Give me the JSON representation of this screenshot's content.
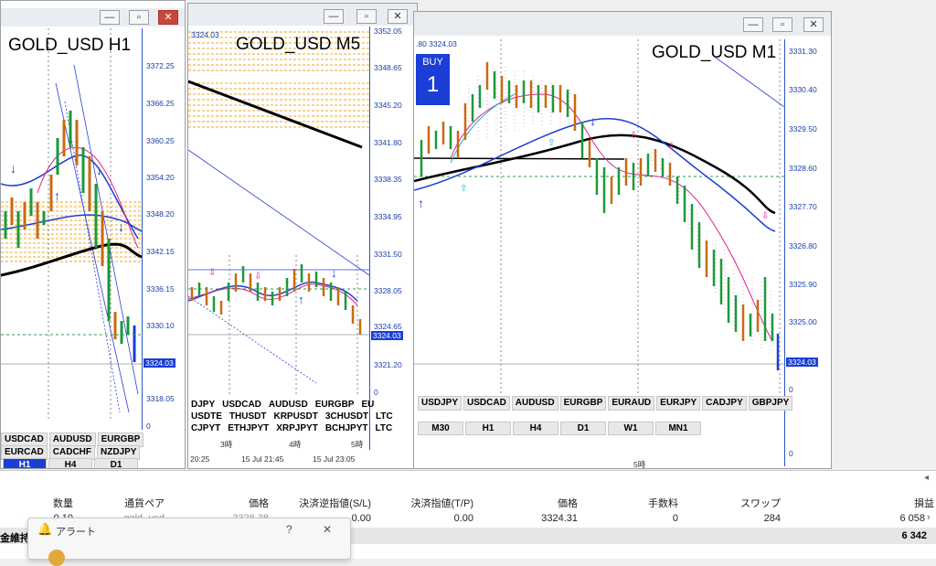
{
  "windows": {
    "h1": {
      "title": "GOLD_USD H1",
      "prices": [
        "3372.25",
        "3366.25",
        "3360.25",
        "3354.20",
        "3348.20",
        "3342.15",
        "3336.15",
        "3330.10",
        "3324.03",
        "3318.05",
        "0"
      ],
      "current_price": "3324.03",
      "symbols_row1": [
        "USDCAD",
        "AUDUSD",
        "EURGBP"
      ],
      "symbols_row2": [
        "EURCAD",
        "CADCHF",
        "NZDJPY"
      ],
      "timeframes": [
        "H1",
        "H4",
        "D1"
      ],
      "active_timeframe": "H1"
    },
    "m5": {
      "title": "GOLD_USD M5",
      "top_price": "3324.03",
      "prices": [
        "3352.05",
        "3348.65",
        "3345.20",
        "3341.80",
        "3338.35",
        "3334.95",
        "3331.50",
        "3328.05",
        "3324.65",
        "3321.20",
        "0"
      ],
      "current_price": "3324.03",
      "symbols_row1": [
        "DJPY",
        "USDCAD",
        "AUDUSD",
        "EURGBP",
        "EU"
      ],
      "symbols_row2": [
        "USDTE",
        "THUSDT",
        "KRPUSDT",
        "3CHUSDT",
        "LTC"
      ],
      "symbols_row3": [
        "CJPYT",
        "ETHJPYT",
        "XRPJPYT",
        "BCHJPYT",
        "LTC"
      ],
      "time_labels": [
        "3時",
        "4時",
        "5時"
      ],
      "datetime_labels": [
        "20:25",
        "15 Jul 21:45",
        "15 Jul 23:05"
      ]
    },
    "m1": {
      "title": "GOLD_USD M1",
      "header_price": ".80 3324.03",
      "buy_label": "BUY",
      "buy_lot": "1",
      "prices": [
        "3331.30",
        "3330.40",
        "3329.50",
        "3328.60",
        "3327.70",
        "3326.80",
        "3325.90",
        "3325.00",
        "3324.03",
        "0",
        "0"
      ],
      "current_price": "3324.03",
      "symbols_row1": [
        "USDJPY",
        "USDCAD",
        "AUDUSD",
        "EURGBP",
        "EURAUD",
        "EURJPY",
        "CADJPY",
        "GBPJPY"
      ],
      "timeframes": [
        "M30",
        "H1",
        "H4",
        "D1",
        "W1",
        "MN1"
      ],
      "time_label": "5時"
    }
  },
  "positions": {
    "headers": [
      "数量",
      "通貨ペア",
      "価格",
      "決済逆指値(S/L)",
      "決済指値(T/P)",
      "価格",
      "手数料",
      "スワップ",
      "損益"
    ],
    "row": {
      "qty": "0.10",
      "pair": "gold_usd",
      "open_price": "3328.38",
      "sl": "0.00",
      "tp": "0.00",
      "price": "3324.31",
      "commission": "0",
      "swap": "284",
      "pnl": "6 058"
    },
    "total_label": "金維持",
    "total": "6 342"
  },
  "alert": {
    "title": "アラート",
    "help": "?",
    "close": "✕"
  }
}
